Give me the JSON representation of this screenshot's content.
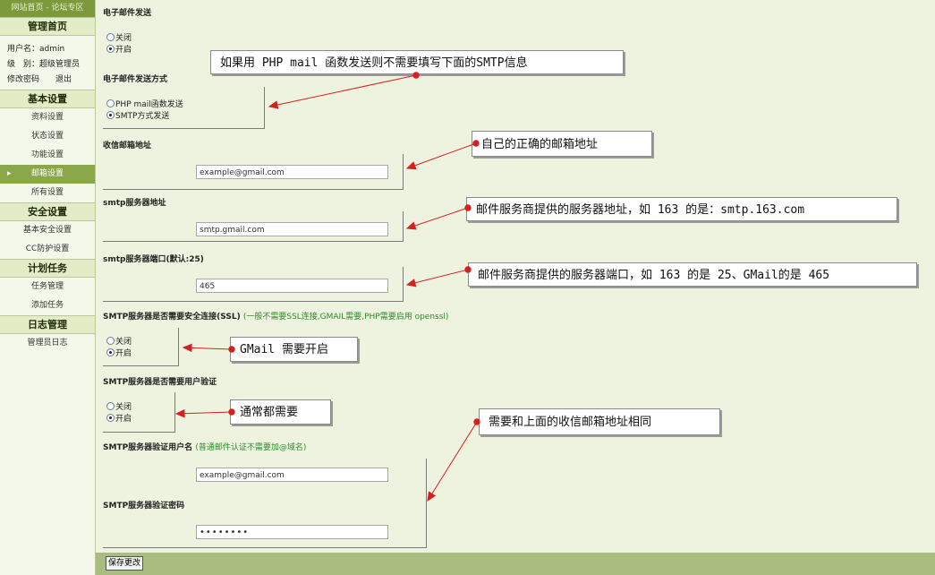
{
  "sidebar": {
    "top_links": "网站首页 - 论坛专区",
    "home_title": "管理首页",
    "user": {
      "username_label": "用户名：",
      "username": "admin",
      "level_label": "级　别：",
      "level": "超级管理员",
      "change_password": "修改密码",
      "logout": "退出"
    },
    "sections": [
      {
        "title": "基本设置",
        "items": [
          "资料设置",
          "状态设置",
          "功能设置",
          "邮箱设置",
          "所有设置"
        ]
      },
      {
        "title": "安全设置",
        "items": [
          "基本安全设置",
          "CC防护设置"
        ]
      },
      {
        "title": "计划任务",
        "items": [
          "任务管理",
          "添加任务"
        ]
      },
      {
        "title": "日志管理",
        "items": [
          "管理员日志"
        ]
      }
    ]
  },
  "form": {
    "email_send": {
      "label": "电子邮件发送",
      "options": [
        "关闭",
        "开启"
      ],
      "selected": "开启"
    },
    "send_method": {
      "label": "电子邮件发送方式",
      "options": [
        "PHP mail函数发送",
        "SMTP方式发送"
      ],
      "selected": "SMTP方式发送"
    },
    "receive_address": {
      "label": "收信邮箱地址",
      "value": "example@gmail.com"
    },
    "smtp_server": {
      "label": "smtp服务器地址",
      "value": "smtp.gmail.com"
    },
    "smtp_port": {
      "label": "smtp服务器端口(默认:25)",
      "value": "465"
    },
    "ssl": {
      "label": "SMTP服务器是否需要安全连接(SSL)",
      "note": "(一般不需要SSL连接,GMAIL需要,PHP需要启用 openssl)",
      "options": [
        "关闭",
        "开启"
      ],
      "selected": "开启"
    },
    "auth": {
      "label": "SMTP服务器是否需要用户验证",
      "options": [
        "关闭",
        "开启"
      ],
      "selected": "开启"
    },
    "auth_user": {
      "label": "SMTP服务器验证用户名",
      "note": "(普通邮件认证不需要加@域名)",
      "value": "example@gmail.com"
    },
    "auth_password": {
      "label": "SMTP服务器验证密码",
      "value": "••••••••"
    },
    "save_label": "保存更改"
  },
  "callouts": {
    "php_mail": "如果用 PHP mail 函数发送则不需要填写下面的SMTP信息",
    "email": "自己的正确的邮箱地址",
    "server": "邮件服务商提供的服务器地址，如 163 的是：smtp.163.com",
    "port": "邮件服务商提供的服务器端口，如 163 的是 25、GMail的是 465",
    "ssl": "GMail 需要开启",
    "auth": "通常都需要",
    "username": "需要和上面的收信邮箱地址相同"
  },
  "colors": {
    "sidebar_bar": "#7c9a3c",
    "active_item": "#8aa74a",
    "page_bg": "#eef3e0",
    "arrow": "#d42020",
    "footer": "#aabd80"
  }
}
